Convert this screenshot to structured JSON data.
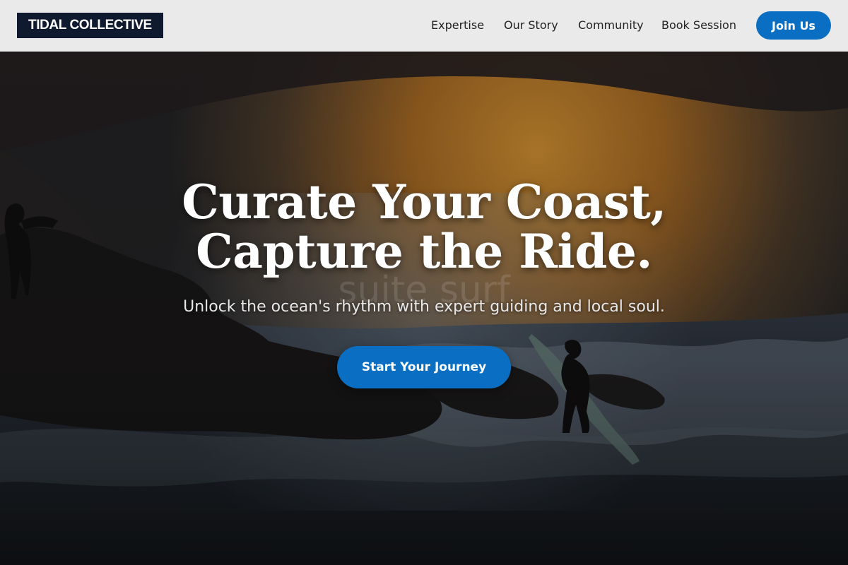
{
  "brand": {
    "name": "TIDAL COLLECTIVE"
  },
  "nav": {
    "items": [
      {
        "label": "Expertise"
      },
      {
        "label": "Our Story"
      },
      {
        "label": "Community"
      },
      {
        "label": "Book Session"
      }
    ],
    "cta_label": "Join Us"
  },
  "hero": {
    "title_line1": "Curate Your Coast,",
    "title_line2": "Capture the Ride.",
    "ghost_text": "suite surf",
    "subtitle": "Unlock the ocean's rhythm with expert guiding and local soul.",
    "cta_label": "Start Your Journey"
  },
  "colors": {
    "accent": "#0a6fc2",
    "logo_bg": "#0f1a2e",
    "header_bg": "#eaeaea"
  }
}
